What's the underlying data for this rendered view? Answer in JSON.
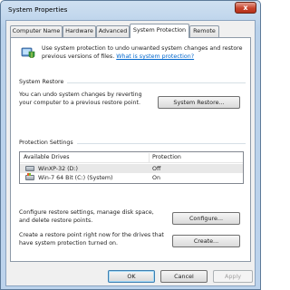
{
  "window": {
    "title": "System Properties",
    "close_glyph": "x"
  },
  "tabs": [
    {
      "label": "Computer Name",
      "active": false
    },
    {
      "label": "Hardware",
      "active": false
    },
    {
      "label": "Advanced",
      "active": false
    },
    {
      "label": "System Protection",
      "active": true
    },
    {
      "label": "Remote",
      "active": false
    }
  ],
  "intro": {
    "text": "Use system protection to undo unwanted system changes and restore previous versions of files.",
    "link": "What is system protection?",
    "icon": "shield-icon"
  },
  "system_restore": {
    "title": "System Restore",
    "description": "You can undo system changes by reverting your computer to a previous restore point.",
    "button": "System Restore..."
  },
  "protection": {
    "title": "Protection Settings",
    "columns": [
      "Available Drives",
      "Protection"
    ],
    "drives": [
      {
        "name": "WinXP-32 (D:)",
        "protection": "Off",
        "icon": "drive-icon",
        "selected": true
      },
      {
        "name": "Win-7 64 Bit (C:) (System)",
        "protection": "On",
        "icon": "system-drive-icon",
        "selected": false
      }
    ],
    "configure_text": "Configure restore settings, manage disk space, and delete restore points.",
    "configure_button": "Configure...",
    "create_text": "Create a restore point right now for the drives that have system protection turned on.",
    "create_button": "Create..."
  },
  "footer": {
    "ok": "OK",
    "cancel": "Cancel",
    "apply": "Apply"
  },
  "colors": {
    "link": "#0066cc",
    "title_bar": "#bcd3ec",
    "close": "#c7432c"
  }
}
